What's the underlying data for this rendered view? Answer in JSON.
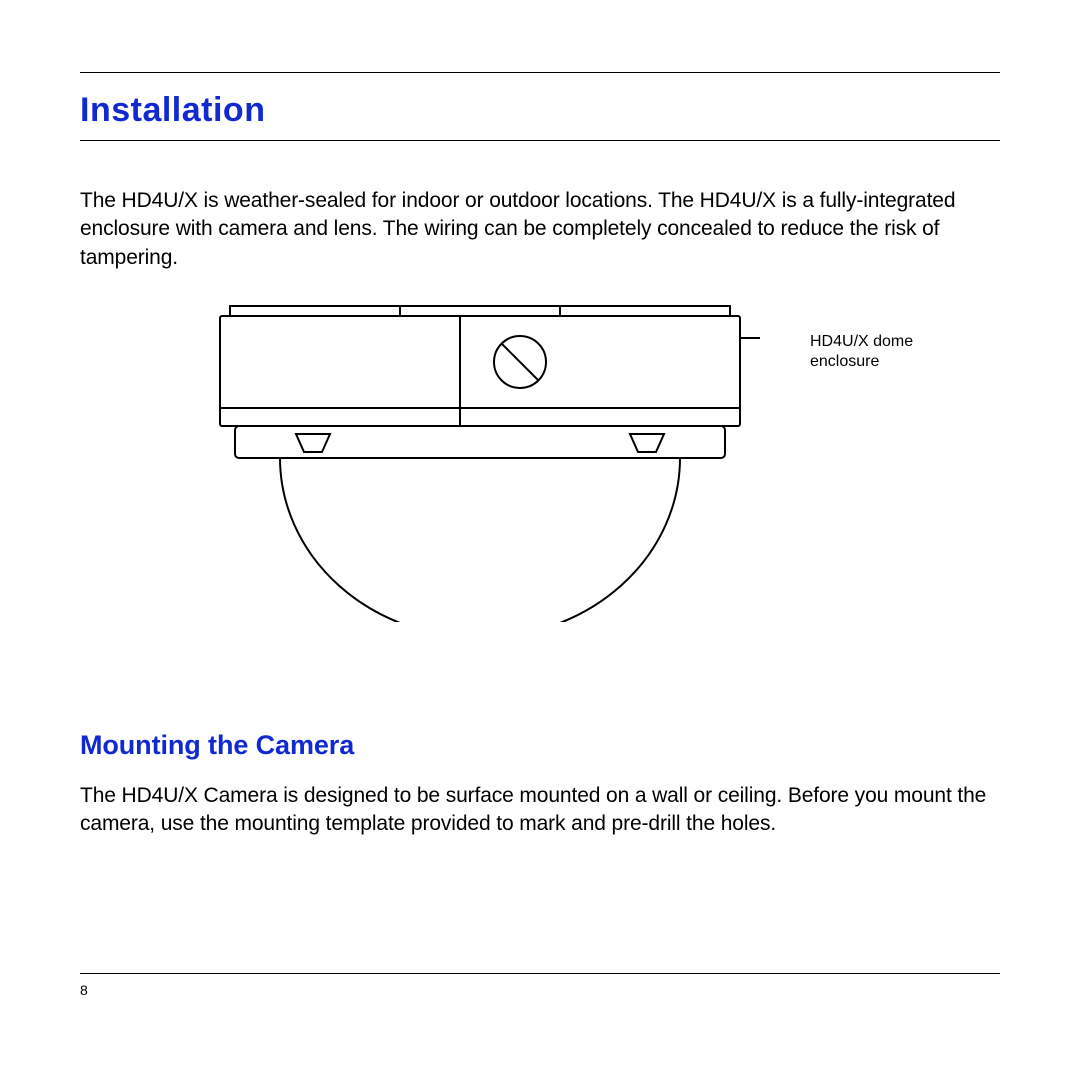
{
  "heading": "Installation",
  "intro": "The HD4U/X is weather-sealed for indoor or outdoor locations. The HD4U/X is a fully-integrated enclosure with camera and lens. The wiring can be completely concealed to reduce the risk of tampering.",
  "figure": {
    "callout": "HD4U/X dome\nenclosure"
  },
  "subheading": "Mounting the Camera",
  "sub_body": "The HD4U/X Camera is designed to be surface mounted on a wall or ceiling. Before you mount the camera, use the mounting template provided to mark and pre-drill the holes.",
  "page_number": "8"
}
